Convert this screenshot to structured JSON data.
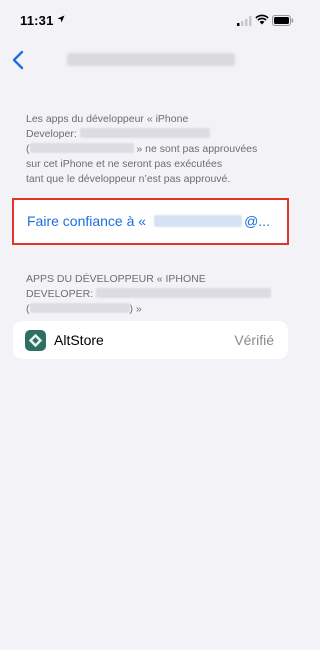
{
  "status_bar": {
    "time": "11:31"
  },
  "nav": {
    "back_icon": "chevron-left-icon"
  },
  "info": {
    "line1": "Les apps du développeur « iPhone",
    "line2_prefix": "Developer: ",
    "line3_prefix": "(",
    "line3_suffix": " » ne sont pas approuvées",
    "line4": "sur cet iPhone et ne seront pas exécutées",
    "line5": "tant que le développeur n’est pas approuvé."
  },
  "trust": {
    "label_prefix": "Faire confiance à «",
    "label_suffix": "@..."
  },
  "section": {
    "line1": "APPS DU DÉVELOPPEUR « IPHONE",
    "line2_prefix": "DEVELOPER: ",
    "line3_prefix": "(",
    "line3_suffix": ") »"
  },
  "app": {
    "name": "AltStore",
    "status": "Vérifié"
  },
  "colors": {
    "accent": "#1c6fe0",
    "highlight": "#e0352b",
    "background": "#f2f2f7",
    "app_icon": "#2f6f63"
  }
}
